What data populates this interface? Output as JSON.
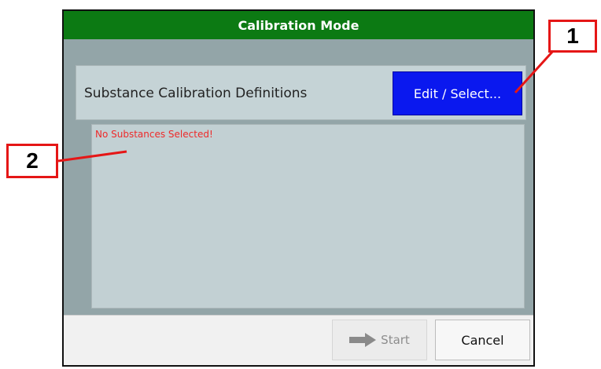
{
  "dialog": {
    "title": "Calibration Mode",
    "header_label": "Substance Calibration Definitions",
    "edit_button_label": "Edit / Select...",
    "empty_message": "No Substances Selected!",
    "start_button_label": "Start",
    "cancel_button_label": "Cancel"
  },
  "annotations": {
    "callout_1": "1",
    "callout_2": "2"
  },
  "colors": {
    "titlebar": "#0c7a13",
    "edit_button": "#0a18ef",
    "empty_message": "#ee2a2a",
    "callout_border": "#e51616"
  },
  "icons": {
    "start": "arrow-right-icon"
  }
}
